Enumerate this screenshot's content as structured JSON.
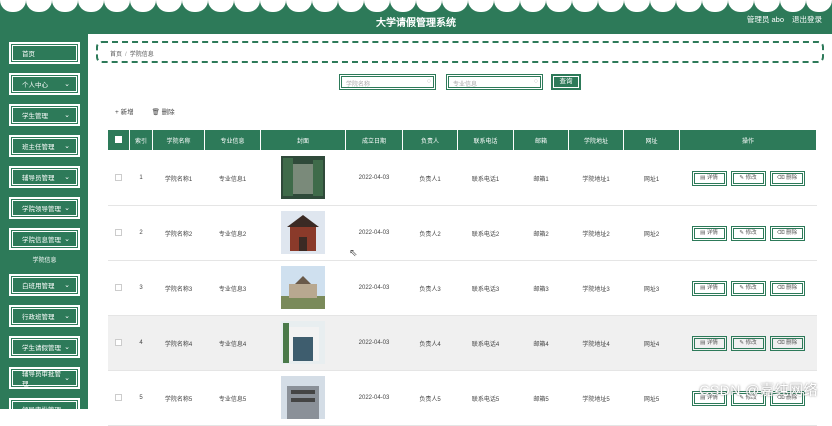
{
  "app": {
    "title": "大学请假管理系统",
    "user_label": "管理员 abo",
    "logout": "退出登录"
  },
  "sidebar": {
    "items": [
      {
        "label": "首页",
        "chevron": false
      },
      {
        "label": "个人中心",
        "chevron": true
      },
      {
        "label": "学生管理",
        "chevron": true
      },
      {
        "label": "班主任管理",
        "chevron": true
      },
      {
        "label": "辅导员管理",
        "chevron": true
      },
      {
        "label": "学院领导管理",
        "chevron": true
      },
      {
        "label": "学院信息管理",
        "chevron": true
      }
    ],
    "sub_item": "学院信息",
    "items_after": [
      {
        "label": "白班用管理",
        "chevron": true
      },
      {
        "label": "行政班管理",
        "chevron": true
      },
      {
        "label": "学生请假管理",
        "chevron": true
      },
      {
        "label": "辅导员审批管理",
        "chevron": true
      },
      {
        "label": "领导审批管理",
        "chevron": true
      }
    ]
  },
  "breadcrumb": {
    "home": "首页",
    "separator": "/",
    "current": "学院信息"
  },
  "search": {
    "college_placeholder": "学院名称",
    "major_placeholder": "专业信息",
    "button": "查询"
  },
  "toolbar": {
    "add": "+ 新增",
    "delete": "🗑 删除"
  },
  "table": {
    "headers": [
      "索引",
      "学院名称",
      "专业信息",
      "封面",
      "成立日期",
      "负责人",
      "联系电话",
      "邮箱",
      "学院地址",
      "网址",
      "操作"
    ],
    "rows": [
      {
        "index": "1",
        "name": "学院名称1",
        "major": "专业信息1",
        "date": "2022-04-03",
        "leader": "负责人1",
        "phone": "联系电话1",
        "email": "邮箱1",
        "address": "学院地址1",
        "url": "网址1"
      },
      {
        "index": "2",
        "name": "学院名称2",
        "major": "专业信息2",
        "date": "2022-04-03",
        "leader": "负责人2",
        "phone": "联系电话2",
        "email": "邮箱2",
        "address": "学院地址2",
        "url": "网址2"
      },
      {
        "index": "3",
        "name": "学院名称3",
        "major": "专业信息3",
        "date": "2022-04-03",
        "leader": "负责人3",
        "phone": "联系电话3",
        "email": "邮箱3",
        "address": "学院地址3",
        "url": "网址3"
      },
      {
        "index": "4",
        "name": "学院名称4",
        "major": "专业信息4",
        "date": "2022-04-03",
        "leader": "负责人4",
        "phone": "联系电话4",
        "email": "邮箱4",
        "address": "学院地址4",
        "url": "网址4"
      },
      {
        "index": "5",
        "name": "学院名称5",
        "major": "专业信息5",
        "date": "2022-04-03",
        "leader": "负责人5",
        "phone": "联系电话5",
        "email": "邮箱5",
        "address": "学院地址5",
        "url": "网址5"
      }
    ],
    "op_labels": {
      "detail": "详情",
      "edit": "修改",
      "delete": "删除"
    }
  },
  "watermark": "CSDN @嘉纯网络",
  "colors": {
    "primary": "#2d7a59"
  }
}
